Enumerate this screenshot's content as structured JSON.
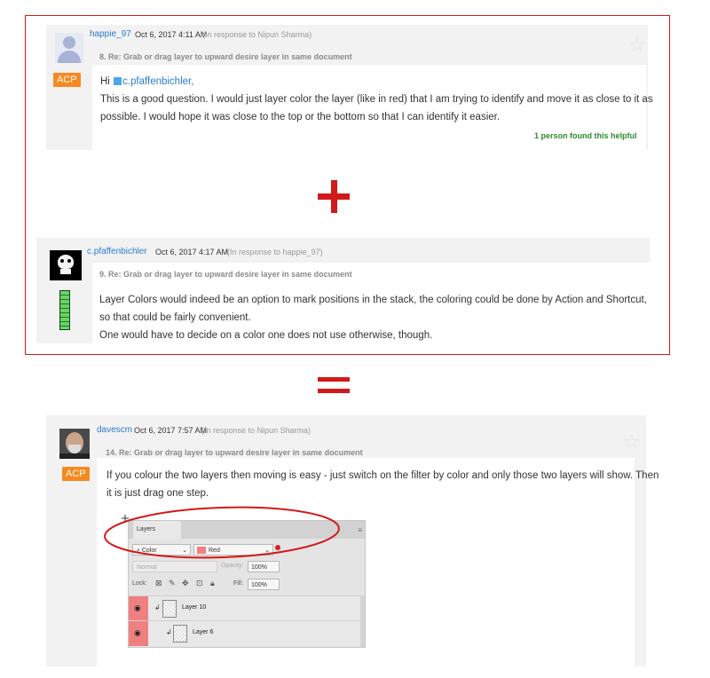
{
  "post1": {
    "username": "happie_97",
    "date": "Oct 6, 2017 4:11 AM",
    "in_response": "(In response to Nipun Sharma)",
    "subject": "8. Re: Grab or drag layer to upward desire layer in same document",
    "badge": "ACP",
    "greeting": "Hi",
    "mention": "c.pfaffenbichler,",
    "body_line1": "This is a good question. I would just layer color the layer (like in red) that I am trying to identify and move it as close to it as",
    "body_line2": "possible. I would hope it was close to the top or the bottom so that I can identify it easier.",
    "helpful": "1 person found this helpful"
  },
  "post2": {
    "username": "c.pfaffenbichler",
    "date": "Oct 6, 2017 4:17 AM",
    "in_response": "(In response to happie_97)",
    "subject": "9. Re: Grab or drag layer to upward desire layer in same document",
    "body_line1": "Layer Colors would indeed be an option to mark positions in the stack, the coloring could be done by Action and Shortcut,",
    "body_line2": "so that could be fairly convenient.",
    "body_line3": "One would have to decide on a color one does not use otherwise, though."
  },
  "post3": {
    "username": "davescm",
    "date": "Oct 6, 2017 7:57 AM",
    "in_response": "(In response to Nipun Sharma)",
    "subject": "14. Re: Grab or drag layer to upward desire layer in same document",
    "badge": "ACP",
    "body_line1": "If you colour the two layers then moving is easy - just switch on the filter by color and only those two layers will show. Then",
    "body_line2": "it is just drag one step."
  },
  "layers_panel": {
    "tab": "Layers",
    "filter_type": "Color",
    "filter_value": "Red",
    "blend_mode": "Normal",
    "opacity_label": "Opacity:",
    "opacity_value": "100%",
    "lock_label": "Lock:",
    "fill_label": "Fill:",
    "fill_value": "100%",
    "layers": [
      "Layer 10",
      "Layer 6"
    ]
  },
  "colors": {
    "accent_red": "#d21a1a",
    "badge_orange": "#f68a20",
    "link_blue": "#2b7bd0",
    "helpful_green": "#2d8a2d",
    "layer_color_red": "#f08080"
  }
}
